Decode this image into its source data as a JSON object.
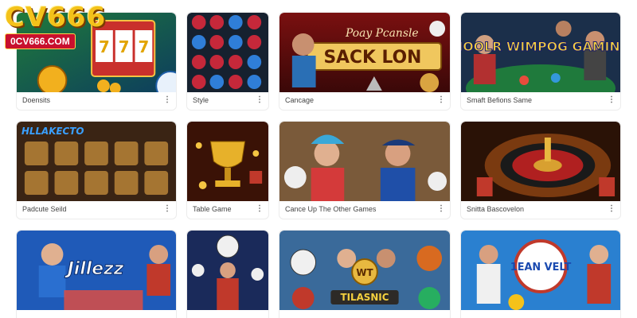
{
  "brand": {
    "logo": "CV666",
    "url": "0CV666.COM"
  },
  "cards": [
    {
      "caption": "Doensits",
      "thumb_text": ""
    },
    {
      "caption": "Style",
      "thumb_text": ""
    },
    {
      "caption": "Cancage",
      "thumb_text": "SACK LON",
      "thumb_subtext": "Poay Pcansle"
    },
    {
      "caption": "Smaft Befions Same",
      "thumb_text": "HOOLR WIMPOG GAMINS"
    },
    {
      "caption": "Padcute Seild",
      "thumb_text": "HLLAKECTO"
    },
    {
      "caption": "Table Game",
      "thumb_text": ""
    },
    {
      "caption": "Cance Up The Other Games",
      "thumb_text": ""
    },
    {
      "caption": "Snitta Bascovelon",
      "thumb_text": ""
    },
    {
      "caption": "",
      "thumb_text": "Jillezz"
    },
    {
      "caption": "",
      "thumb_text": ""
    },
    {
      "caption": "",
      "thumb_text": "TILASNIC",
      "thumb_subtext": "WT"
    },
    {
      "caption": "",
      "thumb_text": "1EAN VELT"
    }
  ],
  "menu_icon": "more-vertical-icon",
  "colors": {
    "logo_gold": "#f4c21a",
    "url_red": "#c8102e",
    "card_border": "#ececec"
  }
}
